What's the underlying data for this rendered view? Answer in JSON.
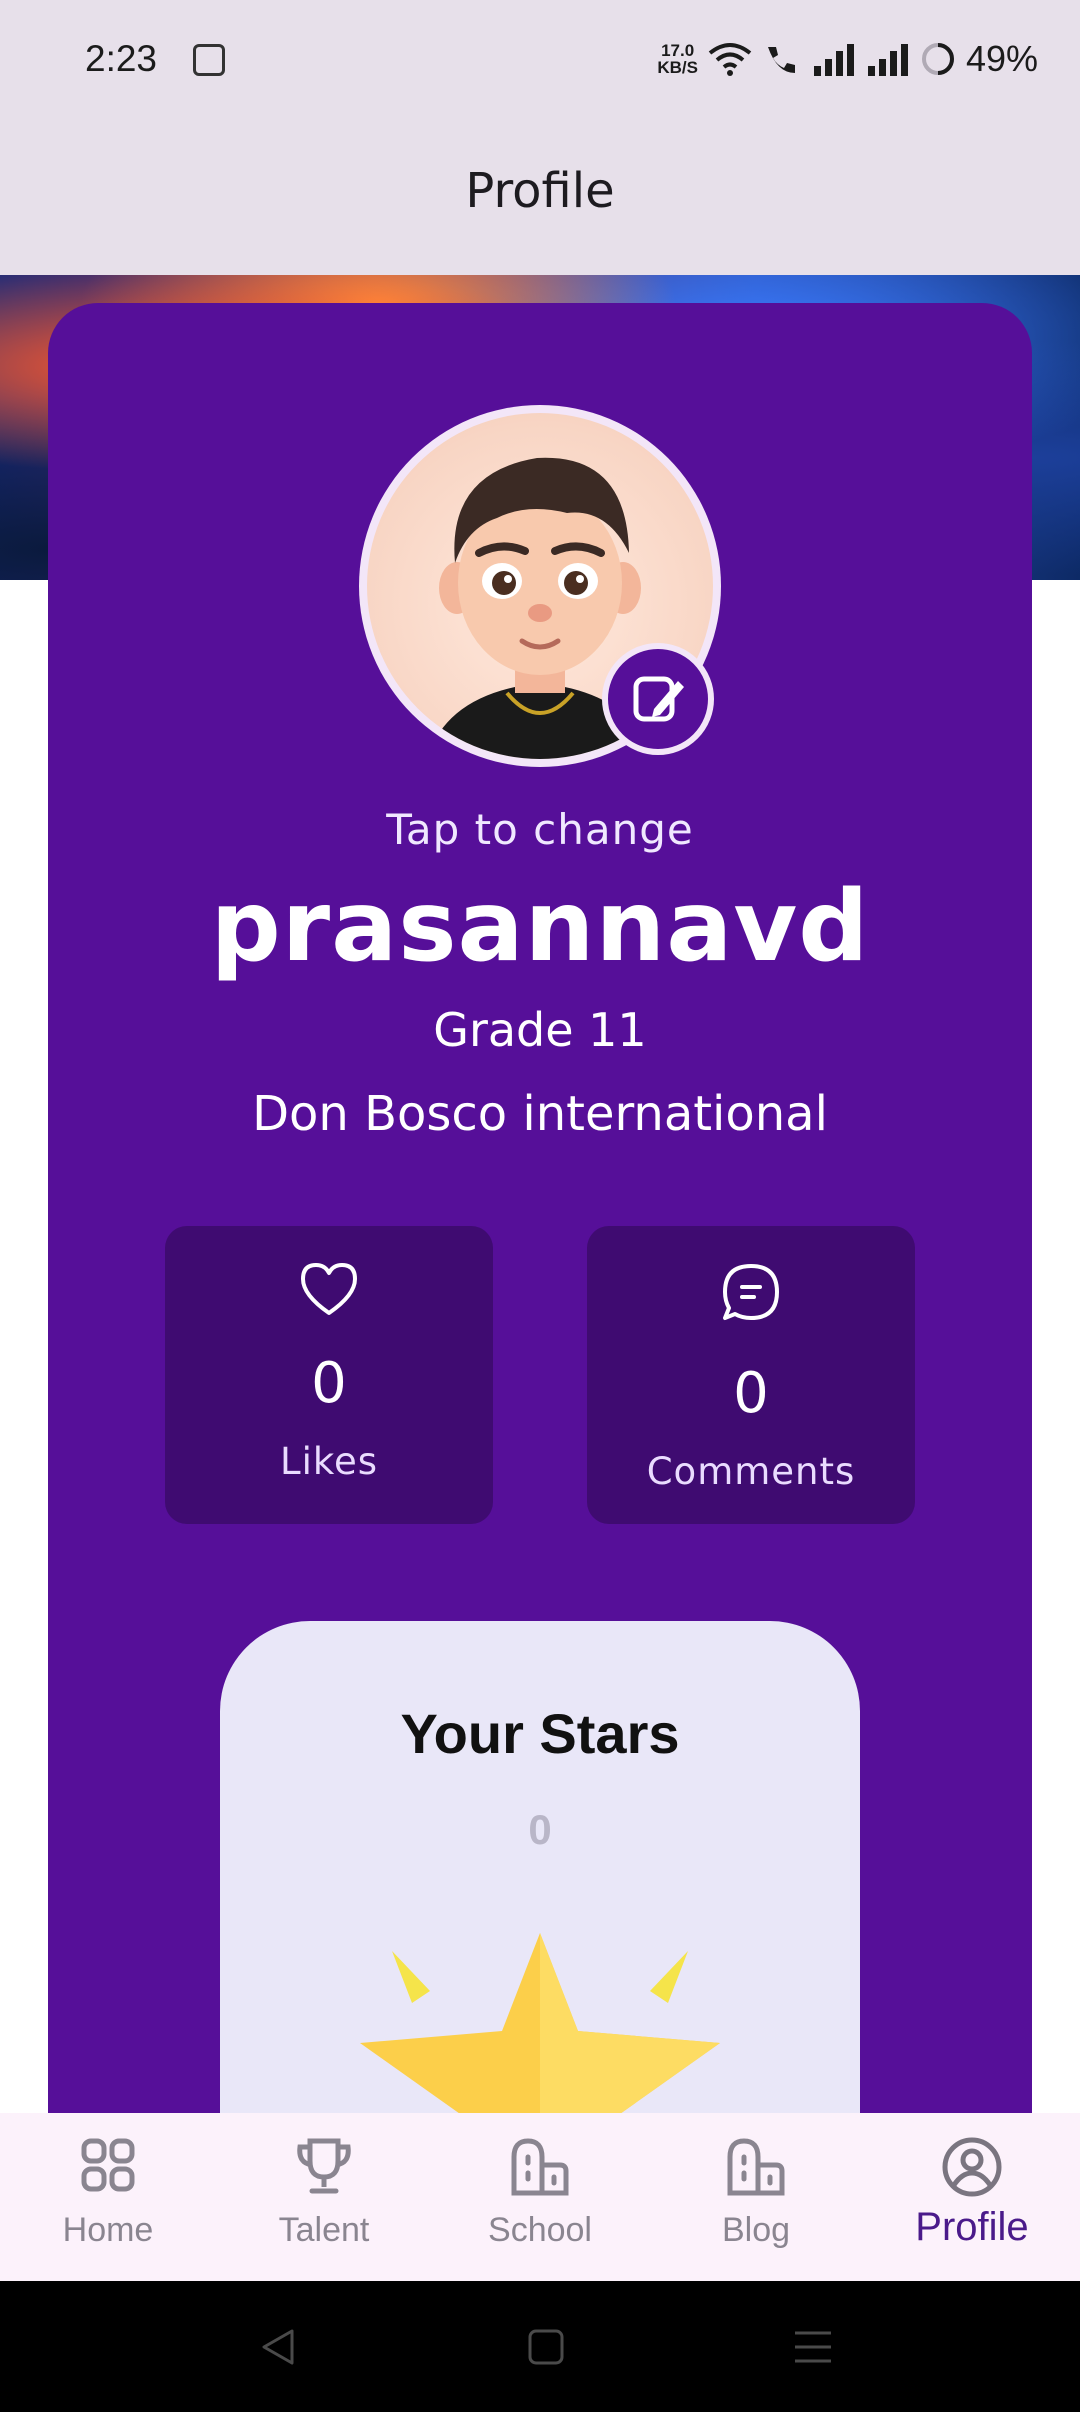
{
  "status_bar": {
    "time": "2:23",
    "net_speed": "17.0",
    "net_unit": "KB/S",
    "battery": "49%"
  },
  "app_bar": {
    "title": "Profile"
  },
  "profile": {
    "tap_to_change": "Tap to change",
    "username": "prasannavd",
    "grade": "Grade 11",
    "school": "Don Bosco international"
  },
  "stats": {
    "likes": {
      "value": "0",
      "label": "Likes",
      "icon": "heart-icon"
    },
    "comments": {
      "value": "0",
      "label": "Comments",
      "icon": "chat-icon"
    }
  },
  "stars": {
    "title": "Your Stars",
    "count": "0"
  },
  "bottom_nav": {
    "items": [
      {
        "label": "Home",
        "icon": "grid-icon"
      },
      {
        "label": "Talent",
        "icon": "trophy-icon"
      },
      {
        "label": "School",
        "icon": "building-icon"
      },
      {
        "label": "Blog",
        "icon": "building-icon"
      },
      {
        "label": "Profile",
        "icon": "account-circle-icon"
      }
    ],
    "active": "Profile"
  },
  "colors": {
    "card": "#560f99",
    "stat_box": "#3f0b71",
    "app_bar": "#e7e0ea",
    "active_nav": "#4a1a8a"
  }
}
